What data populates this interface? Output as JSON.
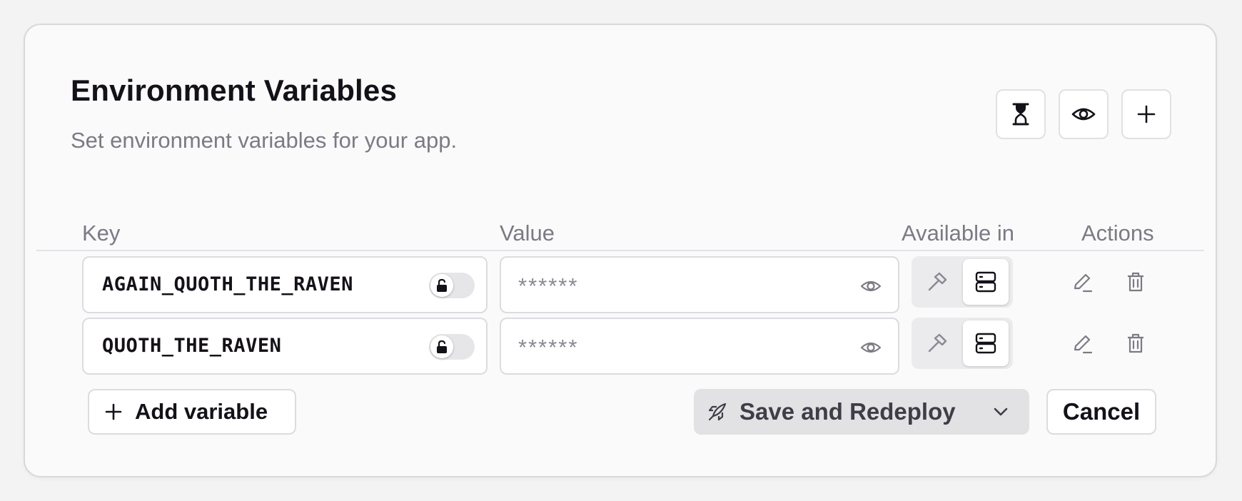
{
  "header": {
    "title": "Environment Variables",
    "subtitle": "Set environment variables for your app.",
    "icon_buttons": [
      "hourglass-icon",
      "eye-icon",
      "plus-icon"
    ]
  },
  "columns": {
    "key": "Key",
    "value": "Value",
    "available_in": "Available in",
    "actions": "Actions"
  },
  "variables": [
    {
      "key": "AGAIN_QUOTH_THE_RAVEN",
      "value_masked": "******",
      "locked": false,
      "available_in": {
        "build": false,
        "runtime": true
      }
    },
    {
      "key": "QUOTH_THE_RAVEN",
      "value_masked": "******",
      "locked": false,
      "available_in": {
        "build": false,
        "runtime": true
      }
    }
  ],
  "footer": {
    "add_label": "Add variable",
    "save_label": "Save and Redeploy",
    "cancel_label": "Cancel"
  },
  "colors": {
    "page_bg": "#f3f3f4",
    "card_bg": "#fafafa",
    "text_primary": "#141118",
    "text_muted": "#7c7a84",
    "border": "#dcdce0",
    "save_bg": "#e2e2e5"
  }
}
